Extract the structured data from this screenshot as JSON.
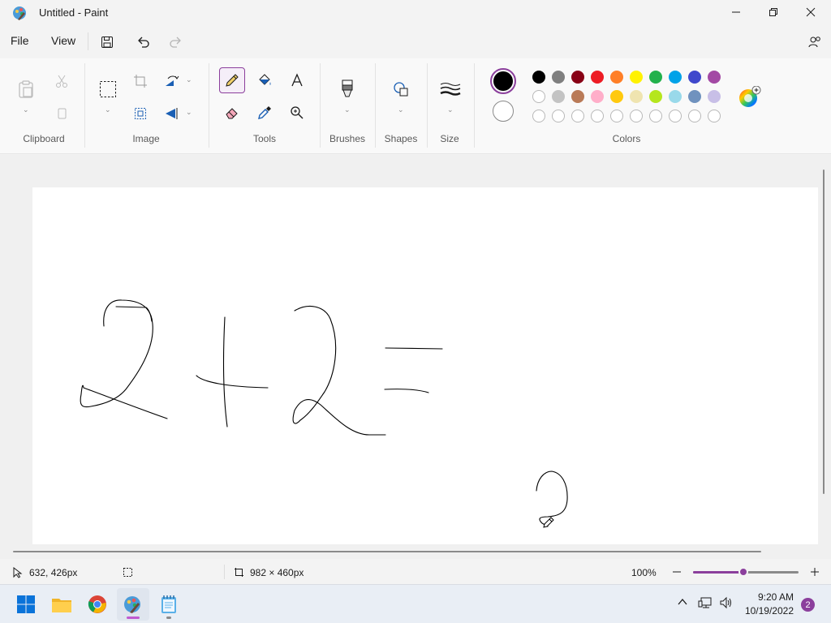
{
  "window": {
    "title": "Untitled - Paint",
    "minimize_icon": "minimize-icon",
    "maximize_icon": "restore-icon",
    "close_icon": "close-icon"
  },
  "menu": {
    "file_label": "File",
    "view_label": "View",
    "save_icon": "save-icon",
    "undo_icon": "undo-icon",
    "redo_icon": "redo-icon",
    "share_icon": "people-icon"
  },
  "ribbon": {
    "groups": {
      "clipboard": "Clipboard",
      "image": "Image",
      "tools": "Tools",
      "brushes": "Brushes",
      "shapes": "Shapes",
      "size": "Size",
      "colors": "Colors"
    },
    "selected_tool": "pencil",
    "primary_color": "#000000",
    "secondary_color": "#ffffff",
    "palette_row1": [
      "#000000",
      "#7f7f7f",
      "#880015",
      "#ed1c24",
      "#ff7f27",
      "#fff200",
      "#22b14c",
      "#00a2e8",
      "#3f48cc",
      "#a349a4"
    ],
    "palette_row2": [
      "#ffffff",
      "#c3c3c3",
      "#b97a57",
      "#ffaec9",
      "#ffc90e",
      "#efe4b0",
      "#b5e61d",
      "#99d9ea",
      "#7092be",
      "#c8bfe7"
    ],
    "accent": "#8b3f9c"
  },
  "status": {
    "cursor_position": "632, 426px",
    "canvas_size": "982 × 460px",
    "zoom": "100%",
    "zoom_level": 0.48
  },
  "taskbar": {
    "time": "9:20 AM",
    "date": "10/19/2022",
    "notification_count": "2",
    "apps": [
      "start",
      "file-explorer",
      "chrome",
      "paint",
      "notepad"
    ]
  }
}
